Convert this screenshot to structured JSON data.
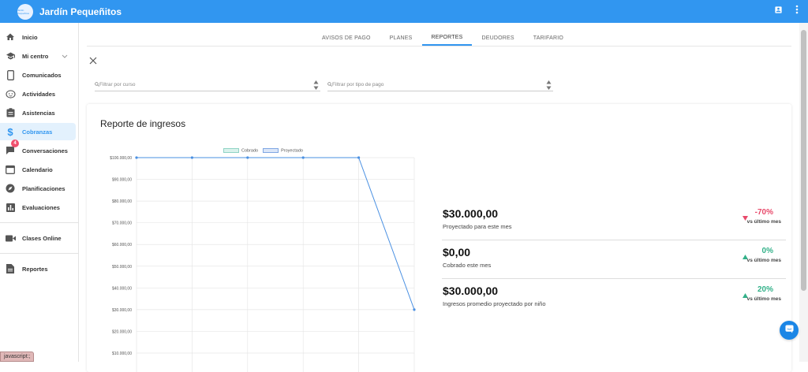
{
  "app": {
    "title": "Jardín Pequeñitos",
    "logo_text": "Jardín Pequeñitos"
  },
  "topbar": {
    "icons": [
      "account-box-icon",
      "more-vert-icon"
    ]
  },
  "sidebar": {
    "items": [
      {
        "label": "Inicio",
        "icon": "home-icon"
      },
      {
        "label": "Mi centro",
        "icon": "school-icon"
      },
      {
        "label": "Comunicados",
        "icon": "phone-icon"
      },
      {
        "label": "Actividades",
        "icon": "face-icon"
      },
      {
        "label": "Asistencias",
        "icon": "clipboard-icon"
      },
      {
        "label": "Cobranzas",
        "icon": "dollar-icon"
      },
      {
        "label": "Conversaciones",
        "icon": "chat-icon",
        "badge": "4"
      },
      {
        "label": "Calendario",
        "icon": "calendar-icon"
      },
      {
        "label": "Planificaciones",
        "icon": "compass-icon"
      },
      {
        "label": "Evaluaciones",
        "icon": "bar-chart-icon"
      },
      {
        "label": "Clases Online",
        "icon": "video-icon"
      },
      {
        "label": "Reportes",
        "icon": "document-icon"
      }
    ]
  },
  "status_bar": "javascript:;",
  "tabs": [
    "AVISOS DE PAGO",
    "PLANES",
    "REPORTES",
    "DEUDORES",
    "TARIFARIO"
  ],
  "active_tab": "REPORTES",
  "filters": {
    "curso_placeholder": "Filtrar por curso",
    "pago_placeholder": "Filtrar por tipo de pago"
  },
  "report": {
    "title": "Reporte de ingresos"
  },
  "chart_data": {
    "type": "line",
    "series": [
      {
        "name": "Cobrado",
        "values": []
      },
      {
        "name": "Proyectado",
        "values": [
          100000,
          100000,
          100000,
          100000,
          100000,
          30000
        ]
      }
    ],
    "y_ticks": [
      "$100.000,00",
      "$90.000,00",
      "$80.000,00",
      "$70.000,00",
      "$60.000,00",
      "$50.000,00",
      "$40.000,00",
      "$30.000,00",
      "$20.000,00",
      "$10.000,00"
    ],
    "ylim": [
      10000,
      100000
    ],
    "grid": true,
    "legend_position": "top",
    "colors": {
      "Cobrado": "#8fd3c5",
      "Proyectado": "#4a90e2"
    }
  },
  "kpis": [
    {
      "value": "$30.000,00",
      "label": "Proyectado para este mes",
      "change": "-70%",
      "direction": "down",
      "vs": "vs último mes"
    },
    {
      "value": "$0,00",
      "label": "Cobrado este mes",
      "change": "0%",
      "direction": "up",
      "vs": "vs último mes"
    },
    {
      "value": "$30.000,00",
      "label": "Ingresos promedio proyectado por niño",
      "change": "20%",
      "direction": "up",
      "vs": "vs último mes"
    }
  ],
  "colors": {
    "primary": "#3196f0",
    "negative": "#e84a6b",
    "positive": "#33b189"
  }
}
